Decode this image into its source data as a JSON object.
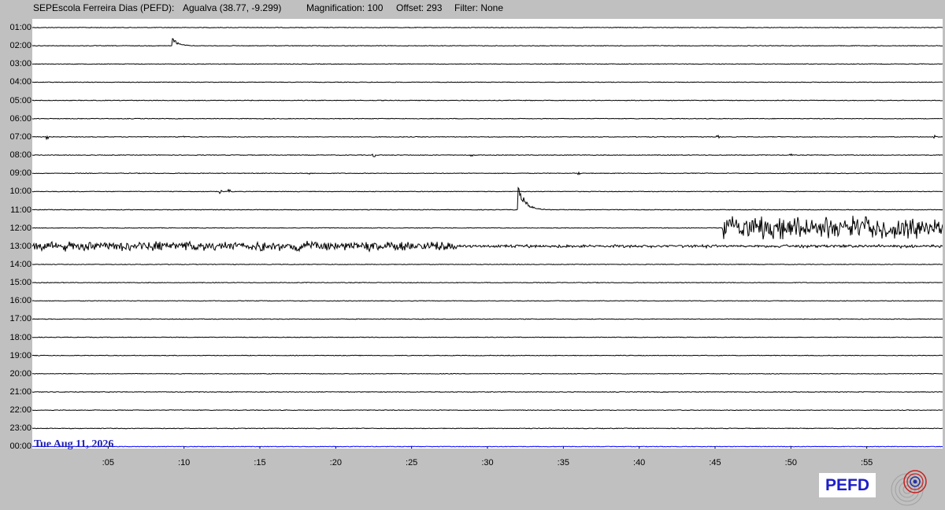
{
  "header": {
    "station": "SEPEscola Ferreira Dias (PEFD):",
    "location": "Agualva (38.77, -9.299)",
    "magnification": "Magnification: 100",
    "offset": "Offset: 293",
    "filter": "Filter: None"
  },
  "date_label": "Tue Aug 11, 2026",
  "badge": "PEFD",
  "colors": {
    "trace": "#000000",
    "date": "#1e1eb4",
    "current_line": "#0000ff",
    "background": "#c0c0c0",
    "plot_bg": "#ffffff"
  },
  "chart_data": {
    "type": "line",
    "description_type": "helicorder",
    "hour_labels": [
      "01:00",
      "02:00",
      "03:00",
      "04:00",
      "05:00",
      "06:00",
      "07:00",
      "08:00",
      "09:00",
      "10:00",
      "11:00",
      "12:00",
      "13:00",
      "14:00",
      "15:00",
      "16:00",
      "17:00",
      "18:00",
      "19:00",
      "20:00",
      "21:00",
      "22:00",
      "23:00",
      "00:00"
    ],
    "minute_ticks": [
      ":05",
      ":10",
      ":15",
      ":20",
      ":25",
      ":30",
      ":35",
      ":40",
      ":45",
      ":50",
      ":55"
    ],
    "minute_values": [
      5,
      10,
      15,
      20,
      25,
      30,
      35,
      40,
      45,
      50,
      55
    ],
    "xlim": [
      0,
      60
    ],
    "events": [
      {
        "row": "02:00",
        "minute": 9.2,
        "amplitude": 14,
        "type": "local"
      },
      {
        "row": "07:00",
        "minute": 1.0,
        "amplitude": 3,
        "type": "spike"
      },
      {
        "row": "07:00",
        "minute": 10.0,
        "amplitude": 2,
        "type": "spike"
      },
      {
        "row": "07:00",
        "minute": 45.2,
        "amplitude": 2,
        "type": "spike"
      },
      {
        "row": "07:00",
        "minute": 59.5,
        "amplitude": 2,
        "type": "spike"
      },
      {
        "row": "08:00",
        "minute": 22.5,
        "amplitude": 2,
        "type": "spike"
      },
      {
        "row": "08:00",
        "minute": 29.0,
        "amplitude": 2,
        "type": "spike"
      },
      {
        "row": "08:00",
        "minute": 50.0,
        "amplitude": 2,
        "type": "spike"
      },
      {
        "row": "09:00",
        "minute": 18.2,
        "amplitude": 2,
        "type": "spike"
      },
      {
        "row": "09:00",
        "minute": 36.0,
        "amplitude": 2,
        "type": "spike"
      },
      {
        "row": "10:00",
        "minute": 12.4,
        "amplitude": 3,
        "type": "spike"
      },
      {
        "row": "10:00",
        "minute": 13.0,
        "amplitude": 3,
        "type": "spike"
      },
      {
        "row": "11:00",
        "minute": 32.0,
        "amplitude": 40,
        "type": "regional"
      }
    ],
    "noise_bursts": [
      {
        "row": "12:00",
        "minute_start": 45.5,
        "minute_end": 60,
        "amplitude": 17
      },
      {
        "row": "13:00",
        "minute_start": 0,
        "minute_end": 28,
        "amplitude": 7
      },
      {
        "row": "13:00",
        "minute_start": 28,
        "minute_end": 60,
        "amplitude": 2
      }
    ],
    "current_row": "00:00"
  }
}
